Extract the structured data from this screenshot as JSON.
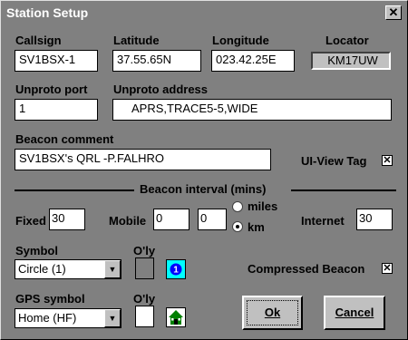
{
  "window": {
    "title": "Station Setup",
    "close_glyph": "✕"
  },
  "labels": {
    "callsign": "Callsign",
    "latitude": "Latitude",
    "longitude": "Longitude",
    "locator": "Locator",
    "unproto_port": "Unproto port",
    "unproto_address": "Unproto address",
    "beacon_comment": "Beacon comment",
    "uiview_tag": "UI-View Tag",
    "beacon_interval": "Beacon interval (mins)",
    "fixed": "Fixed",
    "mobile": "Mobile",
    "miles": "miles",
    "km": "km",
    "internet": "Internet",
    "symbol": "Symbol",
    "overlay1": "O'ly",
    "compressed_beacon": "Compressed Beacon",
    "gps_symbol": "GPS symbol",
    "overlay2": "O'ly"
  },
  "values": {
    "callsign": "SV1BSX-1",
    "latitude": "37.55.65N",
    "longitude": "023.42.25E",
    "locator": "KM17UW",
    "unproto_port": "1",
    "unproto_address": "APRS,TRACE5-5,WIDE",
    "beacon_comment": "SV1BSX's  QRL -P.FALHRO",
    "fixed": "30",
    "mobile_a": "0",
    "mobile_b": "0",
    "internet": "30",
    "symbol": "Circle (1)",
    "gps_symbol": "Home (HF)",
    "uiview_tag_checked": "✕",
    "compressed_checked": "✕",
    "unit_selected": "km"
  },
  "buttons": {
    "ok": "Ok",
    "cancel": "Cancel"
  },
  "colors": {
    "symbol_icon_bg": "#00ffff",
    "home_icon_green": "#008000"
  }
}
